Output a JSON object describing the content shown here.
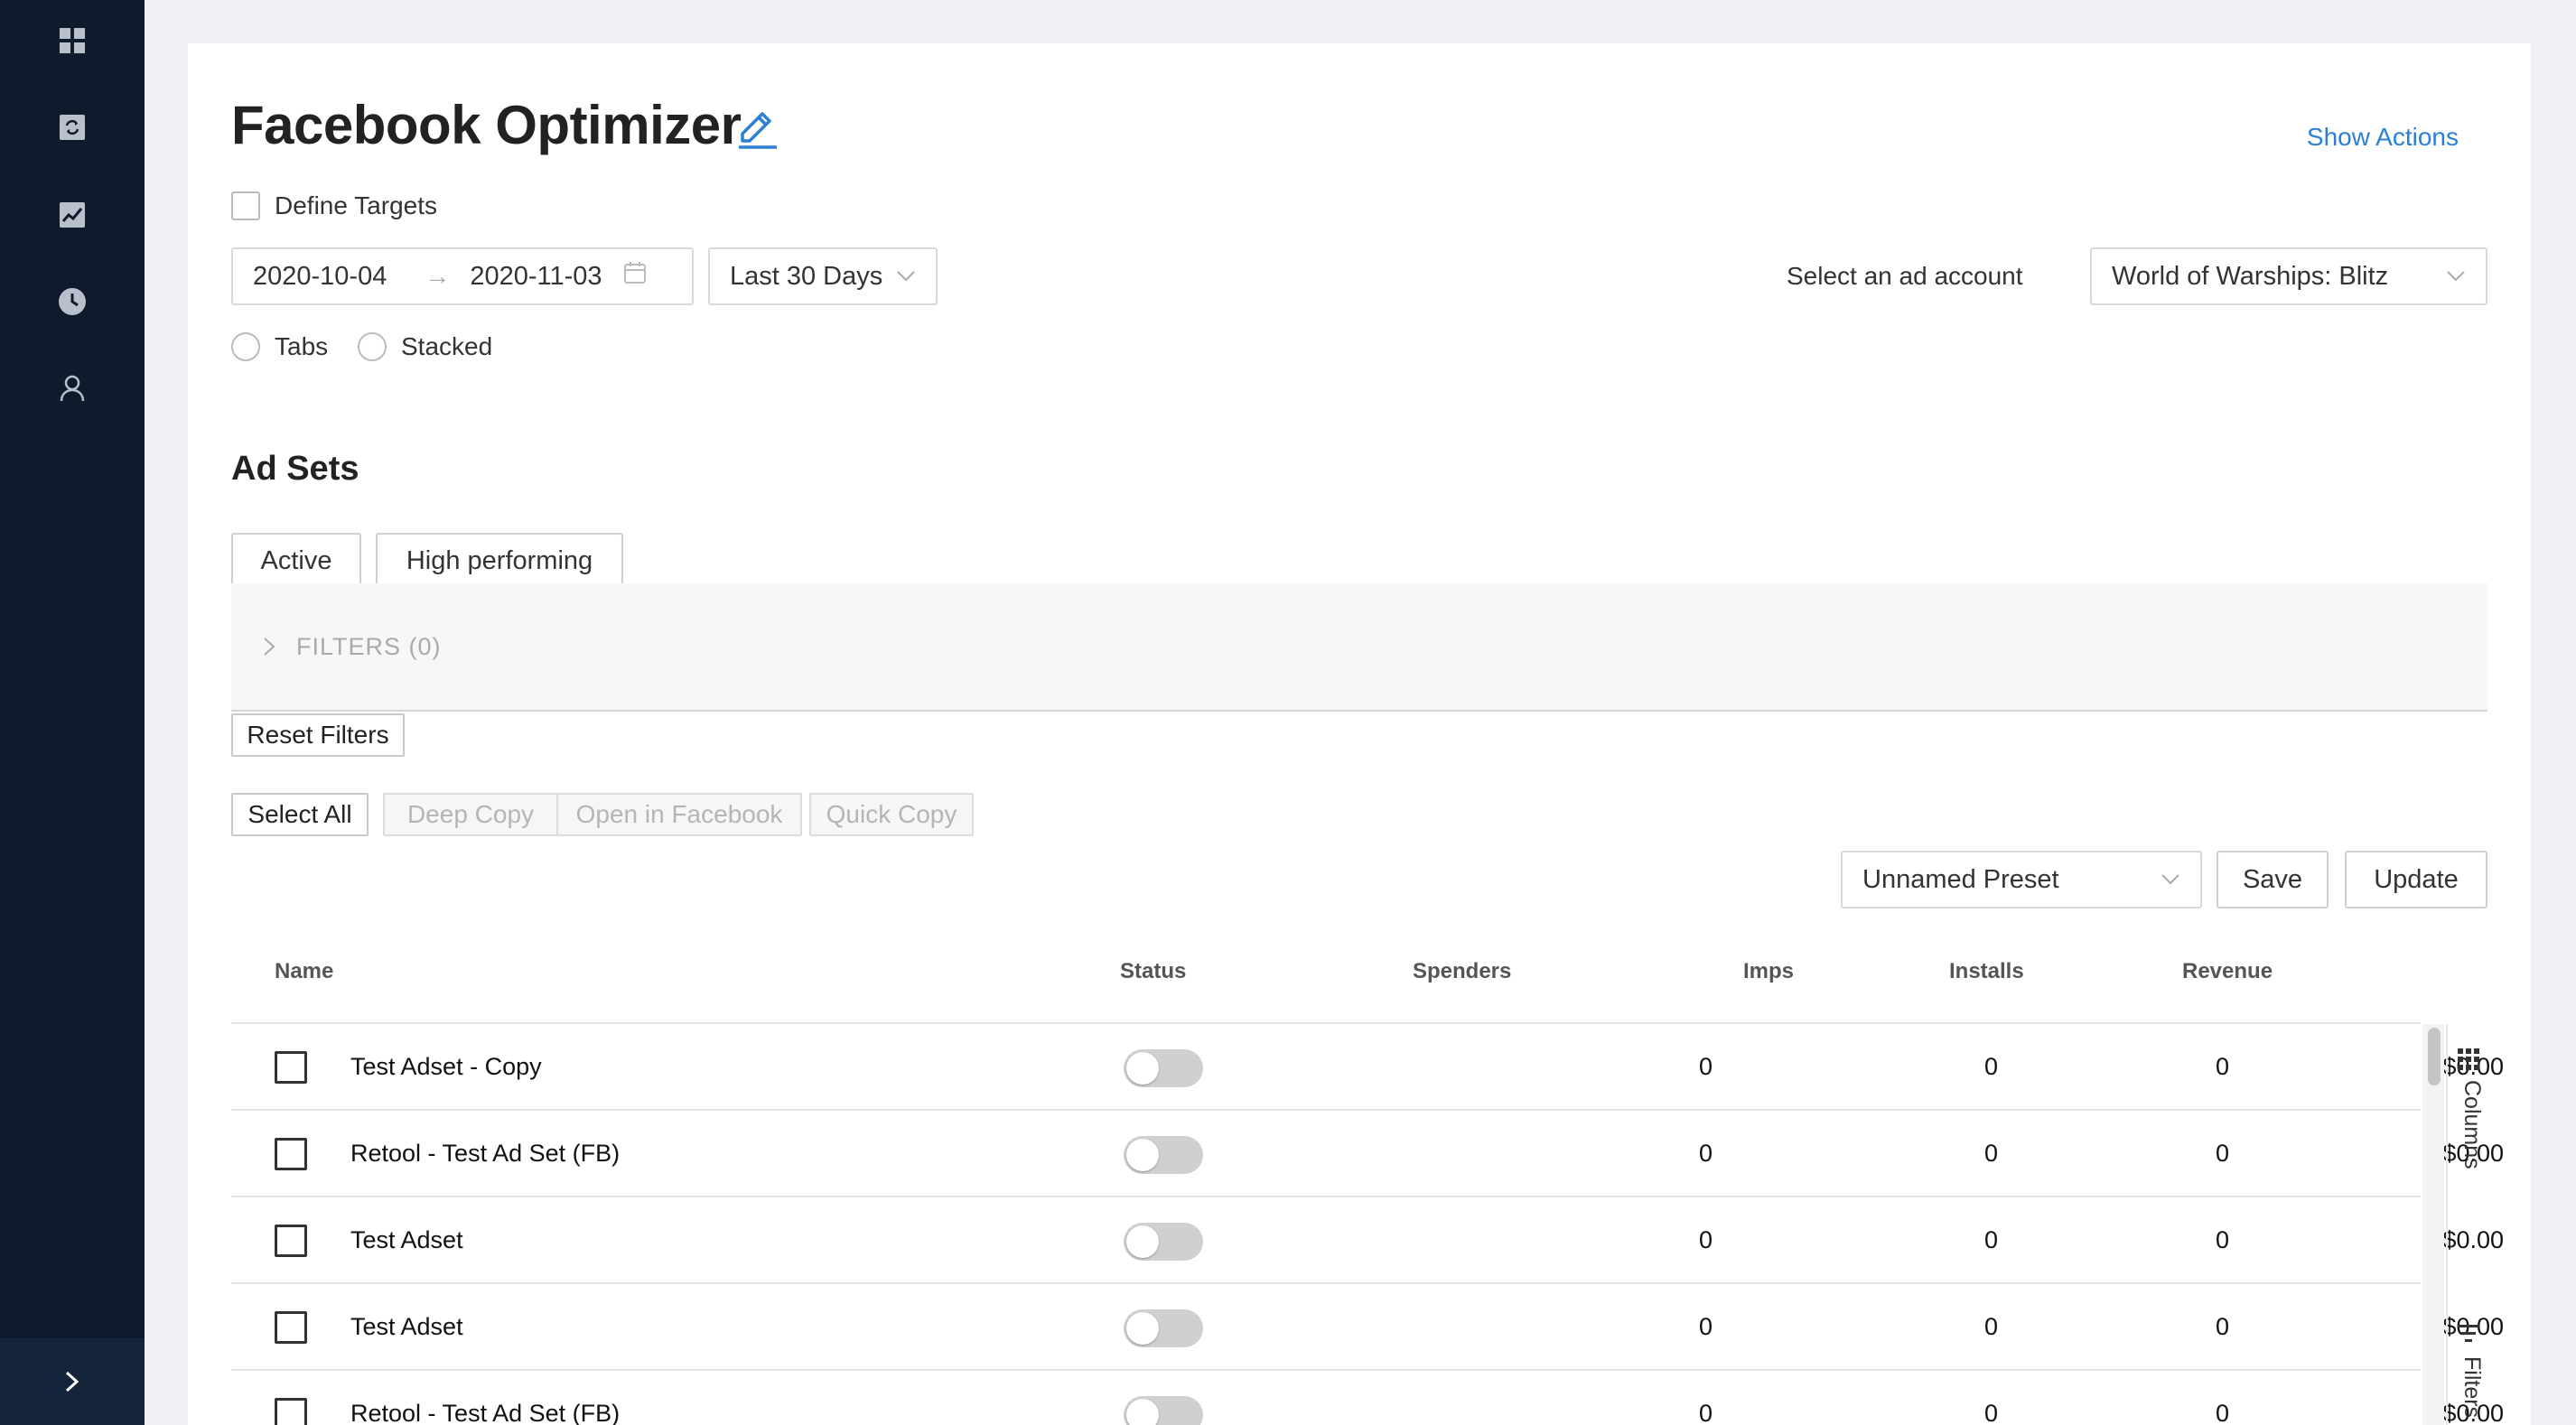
{
  "sidebar": {
    "icons": [
      "dashboard-icon",
      "refresh-icon",
      "chart-icon",
      "clock-icon",
      "user-icon"
    ],
    "expand_icon": "chevron-right-icon"
  },
  "header": {
    "title": "Facebook Optimizer",
    "show_actions": "Show Actions"
  },
  "define_targets": {
    "label": "Define Targets",
    "checked": false
  },
  "date_range": {
    "start": "2020-10-04",
    "separator": "→",
    "end": "2020-11-03"
  },
  "range_preset": {
    "selected": "Last 30 Days"
  },
  "ad_account": {
    "label": "Select an ad account",
    "selected": "World of Warships: Blitz"
  },
  "view_mode": {
    "options": [
      "Tabs",
      "Stacked"
    ]
  },
  "section": {
    "title": "Ad Sets"
  },
  "quick_filters": [
    "Active",
    "High performing"
  ],
  "filters": {
    "label": "FILTERS (0)"
  },
  "actions": {
    "reset_filters": "Reset Filters",
    "select_all": "Select All",
    "deep_copy": "Deep Copy",
    "open_in_facebook": "Open in Facebook",
    "quick_copy": "Quick Copy"
  },
  "preset": {
    "selected": "Unnamed Preset",
    "save": "Save",
    "update": "Update"
  },
  "table": {
    "columns": [
      "Name",
      "Status",
      "Spenders",
      "Imps",
      "Installs",
      "Revenue"
    ],
    "rows": [
      {
        "name": "Test Adset - Copy",
        "status_on": false,
        "spenders": "0",
        "imps": "0",
        "installs": "0",
        "revenue": "$0.00"
      },
      {
        "name": "Retool - Test Ad Set (FB)",
        "status_on": false,
        "spenders": "0",
        "imps": "0",
        "installs": "0",
        "revenue": "$0.00"
      },
      {
        "name": "Test Adset",
        "status_on": false,
        "spenders": "0",
        "imps": "0",
        "installs": "0",
        "revenue": "$0.00"
      },
      {
        "name": "Test Adset",
        "status_on": false,
        "spenders": "0",
        "imps": "0",
        "installs": "0",
        "revenue": "$0.00"
      },
      {
        "name": "Retool - Test Ad Set (FB)",
        "status_on": false,
        "spenders": "0",
        "imps": "0",
        "installs": "0",
        "revenue": "$0.00"
      }
    ],
    "side_tabs": [
      "Columns",
      "Filters"
    ]
  },
  "colors": {
    "sidebar": "#0f1b2d",
    "accent": "#2b7fd4",
    "background": "#eef0f4"
  }
}
